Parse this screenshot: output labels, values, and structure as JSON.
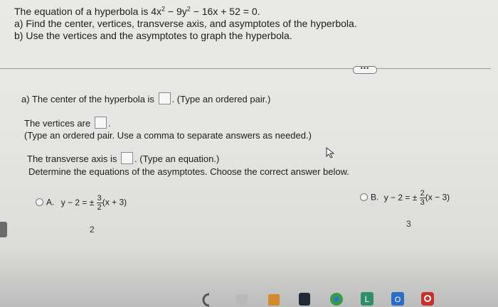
{
  "question": {
    "line1_prefix": "The equation of a hyperbola is 4x",
    "line1_mid": " − 9y",
    "line1_suffix": " − 16x + 52 = 0.",
    "sup1": "2",
    "sup2": "2",
    "part_a": "a) Find the center, vertices, transverse axis, and asymptotes of the hyperbola.",
    "part_b": "b) Use the vertices and the asymptotes to graph the hyperbola."
  },
  "more_button_label": "•••",
  "center": {
    "prefix": "a) The center of the hyperbola is",
    "suffix": ". (Type an ordered pair.)"
  },
  "vertices": {
    "prefix": "The vertices are",
    "suffix": ".",
    "hint": "(Type an ordered pair. Use a comma to separate answers as needed.)"
  },
  "transverse": {
    "prefix": "The transverse axis is",
    "suffix": ". (Type an equation.)"
  },
  "asymptote_prompt": "Determine the equations of the asymptotes. Choose the correct answer below.",
  "choices": [
    {
      "letter": "A.",
      "lhs": "y − 2 = ±",
      "num": "3",
      "den": "2",
      "rhs": "(x + 3)"
    },
    {
      "letter": "B.",
      "lhs": "y − 2 = ±",
      "num": "2",
      "den": "3",
      "rhs": "(x − 3)"
    }
  ],
  "stray_numbers": [
    "2",
    "3"
  ],
  "icons": {
    "cursor": "mouse-pointer-icon",
    "dock": [
      "partial-app-icon",
      "app-icon",
      "app-icon",
      "dark-app-icon",
      "chrome-icon",
      "office-icon",
      "outlook-icon",
      "app-icon"
    ]
  }
}
